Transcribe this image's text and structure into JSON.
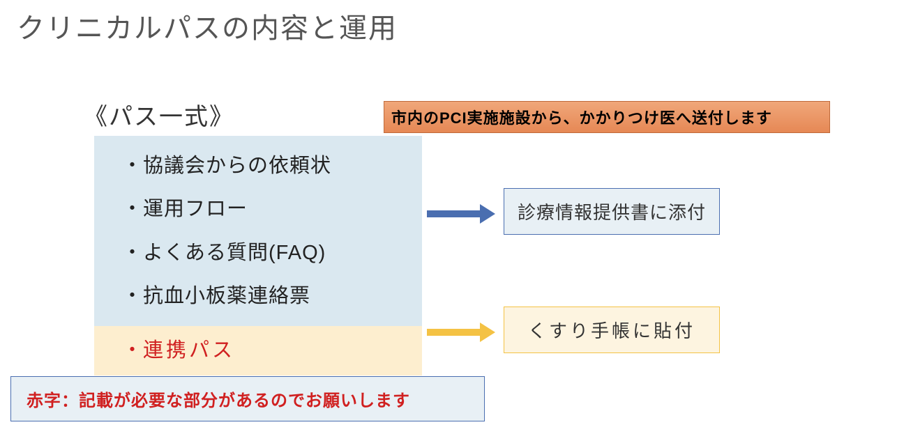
{
  "title": "クリニカルパスの内容と運用",
  "section_header": "《パス一式》",
  "orange_note": "市内のPCI実施施設から、かかりつけ医へ送付します",
  "list": {
    "item1": "・協議会からの依頼状",
    "item2": "・運用フロー",
    "item3": "・よくある質問(FAQ)",
    "item4": "・抗血小板薬連絡票",
    "item5_dot": "・",
    "item5_text": "連携パス"
  },
  "box_blue": "診療情報提供書に添付",
  "box_yellow": "くすり手帳に貼付",
  "footer_note": "赤字：記載が必要な部分があるのでお願いします"
}
